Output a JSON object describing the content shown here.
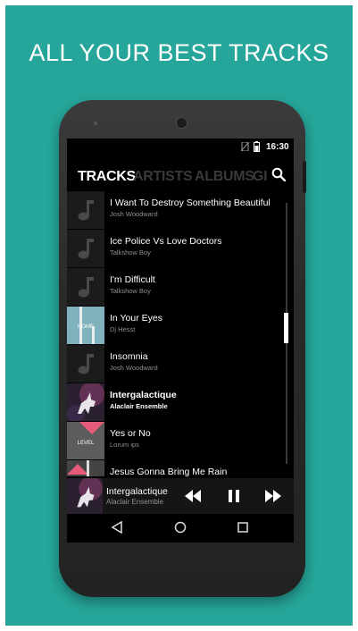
{
  "headline": "ALL YOUR BEST TRACKS",
  "status_bar": {
    "time": "16:30",
    "icons": [
      "no-sim-icon",
      "battery-icon"
    ]
  },
  "tabs": [
    {
      "label": "TRACKS",
      "active": true
    },
    {
      "label": "ARTISTS",
      "active": false
    },
    {
      "label": "ALBUMS",
      "active": false
    },
    {
      "label": "GI",
      "active": false
    }
  ],
  "search_icon": "search-icon",
  "tracks": [
    {
      "title": "I Want To Destroy Something Beautiful",
      "artist": "Josh Woodward",
      "art": "music-note",
      "playing": false
    },
    {
      "title": "Ice Police Vs Love Doctors",
      "artist": "Talkshow Boy",
      "art": "music-note",
      "playing": false
    },
    {
      "title": "I'm Difficult",
      "artist": "Talkshow Boy",
      "art": "music-note",
      "playing": false
    },
    {
      "title": "In Your Eyes",
      "artist": "Dj Hesst",
      "art": "home-cover",
      "art_text": "HOME",
      "playing": false
    },
    {
      "title": "Insomnia",
      "artist": "Josh Woodward",
      "art": "music-note",
      "playing": false
    },
    {
      "title": "Intergalactique",
      "artist": "Alaclair Ensemble",
      "art": "unicorn-cover",
      "playing": true
    },
    {
      "title": "Yes or No",
      "artist": "Lorum ips",
      "art": "level-cover",
      "art_text": "LEVEL",
      "playing": false
    },
    {
      "title": "Jesus Gonna Bring Me Rain",
      "artist": "",
      "art": "pink-cover",
      "playing": false
    }
  ],
  "now_playing": {
    "title": "Intergalactique",
    "artist": "Alaclair Ensemble"
  },
  "player_controls": [
    "rewind-icon",
    "pause-icon",
    "fast-forward-icon"
  ],
  "nav_buttons": [
    "back-icon",
    "home-icon",
    "recents-icon"
  ],
  "colors": {
    "background": "#26a69a",
    "screen": "#000000",
    "accent": "#ffffff",
    "inactive_tab": "#3a3a3a"
  }
}
